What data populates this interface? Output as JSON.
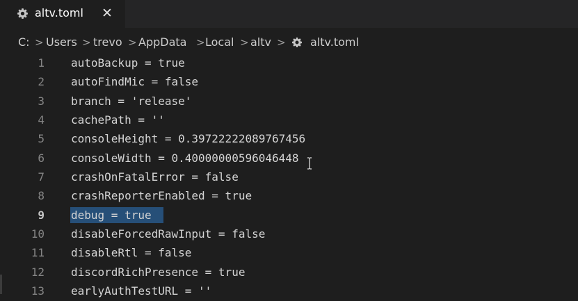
{
  "tab": {
    "icon": "gear-icon",
    "label": "altv.toml",
    "close_glyph": "✕"
  },
  "breadcrumb": {
    "items": [
      "C:",
      "Users",
      "trevo",
      "AppData",
      "Local",
      "altv",
      "altv.toml"
    ],
    "separator": ">",
    "file_icon": "gear-icon"
  },
  "editor": {
    "active_line": 9,
    "selection": "debug = true",
    "lines": [
      {
        "num": "1",
        "text": "autoBackup = true"
      },
      {
        "num": "2",
        "text": "autoFindMic = false"
      },
      {
        "num": "3",
        "text": "branch = 'release'"
      },
      {
        "num": "4",
        "text": "cachePath = ''"
      },
      {
        "num": "5",
        "text": "consoleHeight = 0.39722222089767456"
      },
      {
        "num": "6",
        "text": "consoleWidth = 0.40000000596046448"
      },
      {
        "num": "7",
        "text": "crashOnFatalError = false"
      },
      {
        "num": "8",
        "text": "crashReporterEnabled = true"
      },
      {
        "num": "9",
        "text": "debug = true"
      },
      {
        "num": "10",
        "text": "disableForcedRawInput = false"
      },
      {
        "num": "11",
        "text": "disableRtl = false"
      },
      {
        "num": "12",
        "text": "discordRichPresence = true"
      },
      {
        "num": "13",
        "text": "earlyAuthTestURL = ''"
      }
    ]
  },
  "colors": {
    "background": "#1e1e1e",
    "selection": "#264f78",
    "line_number": "#858585",
    "text": "#d4d4d4"
  }
}
